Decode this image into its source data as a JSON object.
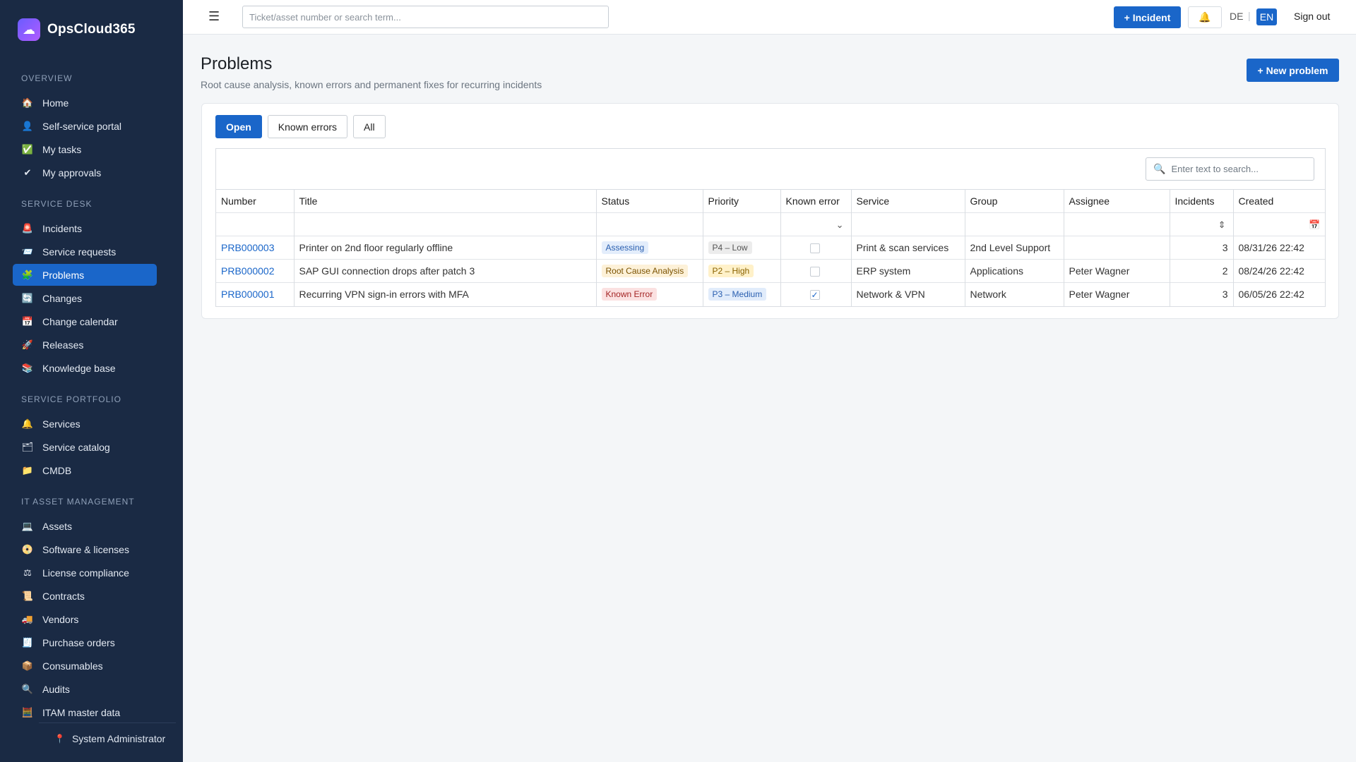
{
  "brand": {
    "name": "OpsCloud365",
    "logo_icon": "cloud-logo-icon"
  },
  "sidebar": {
    "sections": [
      {
        "title": "OVERVIEW",
        "items": [
          {
            "label": "Home",
            "icon": "🏠"
          },
          {
            "label": "Self-service portal",
            "icon": "👤"
          },
          {
            "label": "My tasks",
            "icon": "✅"
          },
          {
            "label": "My approvals",
            "icon": "✔"
          }
        ]
      },
      {
        "title": "SERVICE DESK",
        "items": [
          {
            "label": "Incidents",
            "icon": "🚨"
          },
          {
            "label": "Service requests",
            "icon": "📨"
          },
          {
            "label": "Problems",
            "icon": "🧩",
            "active": true
          },
          {
            "label": "Changes",
            "icon": "🔄"
          },
          {
            "label": "Change calendar",
            "icon": "📅"
          },
          {
            "label": "Releases",
            "icon": "🚀"
          },
          {
            "label": "Knowledge base",
            "icon": "📚"
          }
        ]
      },
      {
        "title": "SERVICE PORTFOLIO",
        "items": [
          {
            "label": "Services",
            "icon": "🔔"
          },
          {
            "label": "Service catalog",
            "icon": "🗂"
          },
          {
            "label": "CMDB",
            "icon": "📁"
          }
        ]
      },
      {
        "title": "IT ASSET MANAGEMENT",
        "items": [
          {
            "label": "Assets",
            "icon": "💻"
          },
          {
            "label": "Software & licenses",
            "icon": "📀"
          },
          {
            "label": "License compliance",
            "icon": "⚖"
          },
          {
            "label": "Contracts",
            "icon": "📜"
          },
          {
            "label": "Vendors",
            "icon": "🚚"
          },
          {
            "label": "Purchase orders",
            "icon": "🧾"
          },
          {
            "label": "Consumables",
            "icon": "📦"
          },
          {
            "label": "Audits",
            "icon": "🔍"
          },
          {
            "label": "ITAM master data",
            "icon": "🧮"
          }
        ]
      }
    ],
    "user": "System Administrator"
  },
  "topbar": {
    "search_placeholder": "Ticket/asset number or search term...",
    "incident_button": "+ Incident",
    "lang_de": "DE",
    "lang_sep": "|",
    "lang_en": "EN",
    "signout": "Sign out"
  },
  "page": {
    "title": "Problems",
    "subtitle": "Root cause analysis, known errors and permanent fixes for recurring incidents",
    "new_button": "+ New problem"
  },
  "tabs": [
    {
      "label": "Open",
      "active": true
    },
    {
      "label": "Known errors",
      "active": false
    },
    {
      "label": "All",
      "active": false
    }
  ],
  "grid": {
    "search_placeholder": "Enter text to search...",
    "columns": [
      "Number",
      "Title",
      "Status",
      "Priority",
      "Known error",
      "Service",
      "Group",
      "Assignee",
      "Incidents",
      "Created"
    ],
    "rows": [
      {
        "number": "PRB000003",
        "title": "Printer on 2nd floor regularly offline",
        "status": "Assessing",
        "status_bg": "#e3edfb",
        "status_fg": "#2a5fb0",
        "priority": "P4 – Low",
        "priority_bg": "#ececec",
        "priority_fg": "#555555",
        "known_error": false,
        "service": "Print & scan services",
        "group": "2nd Level Support",
        "assignee": "",
        "incidents": "3",
        "created": "08/31/26 22:42"
      },
      {
        "number": "PRB000002",
        "title": "SAP GUI connection drops after patch 3",
        "status": "Root Cause Analysis",
        "status_bg": "#fdf1d8",
        "status_fg": "#7a5200",
        "priority": "P2 – High",
        "priority_bg": "#fff1c9",
        "priority_fg": "#8a6200",
        "known_error": false,
        "service": "ERP system",
        "group": "Applications",
        "assignee": "Peter Wagner",
        "incidents": "2",
        "created": "08/24/26 22:42"
      },
      {
        "number": "PRB000001",
        "title": "Recurring VPN sign-in errors with MFA",
        "status": "Known Error",
        "status_bg": "#fbe1e1",
        "status_fg": "#a32424",
        "priority": "P3 – Medium",
        "priority_bg": "#e1ecfb",
        "priority_fg": "#2a5fb0",
        "known_error": true,
        "service": "Network & VPN",
        "group": "Network",
        "assignee": "Peter Wagner",
        "incidents": "3",
        "created": "06/05/26 22:42"
      }
    ]
  }
}
